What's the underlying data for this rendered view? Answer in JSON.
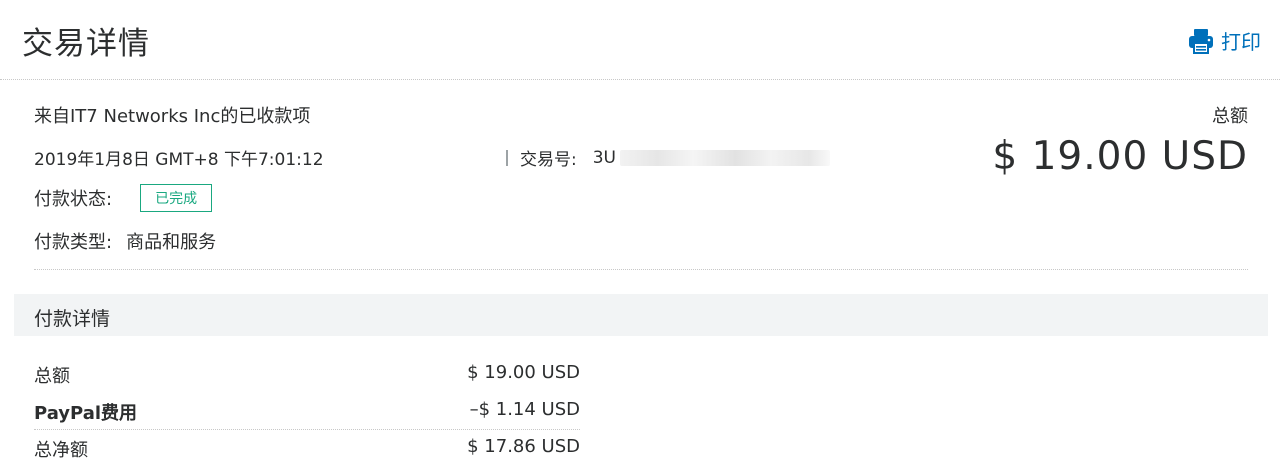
{
  "header": {
    "title": "交易详情",
    "print_label": "打印",
    "print_icon": "printer-icon",
    "accent_color": "#0070ba"
  },
  "summary": {
    "merchant": "来自IT7 Networks Inc的已收款项",
    "date": "2019年1月8日 GMT+8 下午7:01:12",
    "transaction_label": "交易号:",
    "transaction_id": "3U",
    "status_label": "付款状态:",
    "status_value": "已完成",
    "status_color": "#1aa880",
    "type_label": "付款类型:",
    "type_value": "商品和服务",
    "total_label": "总额",
    "total_amount": "$ 19.00 USD"
  },
  "details": {
    "section_title": "付款详情",
    "rows": [
      {
        "label": "总额",
        "amount": "$ 19.00 USD"
      },
      {
        "label": "PayPal费用",
        "amount": "–$ 1.14 USD"
      },
      {
        "label": "总净额",
        "amount": "$ 17.86 USD"
      }
    ]
  }
}
